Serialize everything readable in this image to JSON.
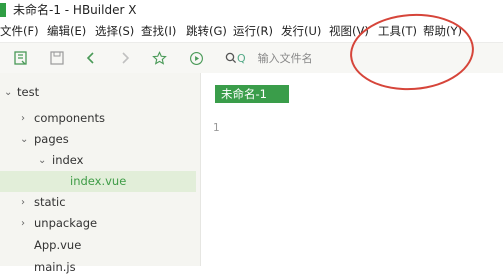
{
  "window": {
    "title": "未命名-1 - HBuilder X"
  },
  "menu": {
    "file": "文件(F)",
    "edit": "编辑(E)",
    "select": "选择(S)",
    "find": "查找(I)",
    "goto": "跳转(G)",
    "run": "运行(R)",
    "publish": "发行(U)",
    "view": "视图(V)",
    "tools": "工具(T)",
    "help": "帮助(Y)"
  },
  "toolbar": {
    "search_prefix": "Q",
    "search_placeholder": "输入文件名"
  },
  "tree": {
    "root": "test",
    "components": "components",
    "pages": "pages",
    "index": "index",
    "index_vue": "index.vue",
    "static": "static",
    "unpackage": "unpackage",
    "app_vue": "App.vue",
    "main_js": "main.js"
  },
  "editor": {
    "tab_label": "未命名-1",
    "line_number": "1"
  },
  "colors": {
    "accent": "#3a9d4a",
    "selected_row": "#e2eed9",
    "annotation": "#d6453a"
  }
}
